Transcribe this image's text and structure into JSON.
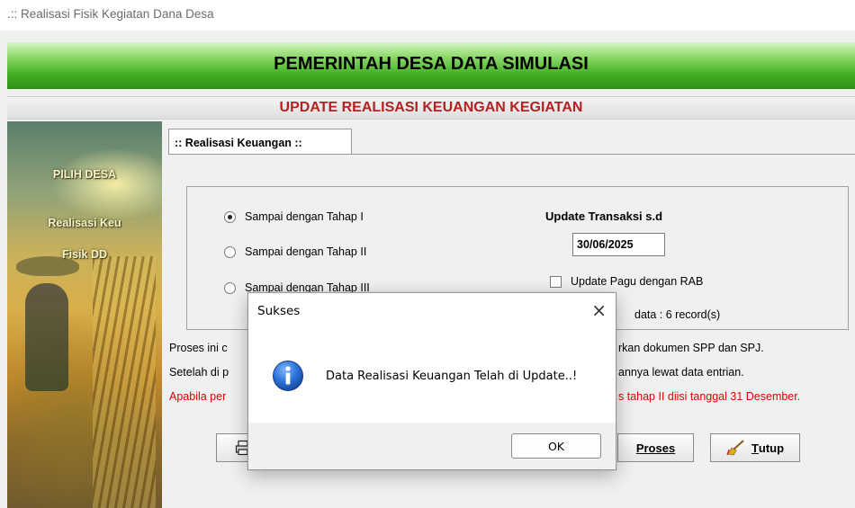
{
  "window": {
    "title": ".:: Realisasi Fisik Kegiatan Dana Desa"
  },
  "header": {
    "title": "PEMERINTAH DESA DATA SIMULASI",
    "subtitle": "UPDATE REALISASI KEUANGAN KEGIATAN"
  },
  "sidebar": {
    "items": [
      {
        "label": "PILIH DESA"
      },
      {
        "label": "Realisasi Keu"
      },
      {
        "label": "Fisik DD"
      }
    ]
  },
  "tab": {
    "label": ":: Realisasi Keuangan ::"
  },
  "options": {
    "radios": [
      {
        "label": "Sampai dengan Tahap I",
        "selected": true
      },
      {
        "label": "Sampai dengan Tahap II",
        "selected": false
      },
      {
        "label": "Sampai dengan Tahap III",
        "selected": false
      }
    ],
    "update_label": "Update Transaksi s.d",
    "update_date": "30/06/2025",
    "pagu_checkbox_label": "Update Pagu dengan RAB",
    "pagu_checked": false,
    "record_text": "data : 6 record(s)"
  },
  "info": {
    "line1_left": "Proses ini c",
    "line1_right": "rkan dokumen SPP dan SPJ.",
    "line2_left": "Setelah di p",
    "line2_right": "annya lewat data entrian.",
    "line3_left": "Apabila per",
    "line3_right": "s tahap II diisi tanggal 31 Desember."
  },
  "buttons": {
    "proses": "Proses",
    "tutup_underline": "T",
    "tutup_rest": "utup"
  },
  "dialog": {
    "title": "Sukses",
    "close": "×",
    "message": "Data Realisasi Keuangan Telah di Update..!",
    "ok": "OK"
  },
  "colors": {
    "header_green": "#3fae22",
    "subtitle_red": "#b32121",
    "warning_red": "#e00000",
    "info_icon_blue": "#1f5fbf"
  }
}
